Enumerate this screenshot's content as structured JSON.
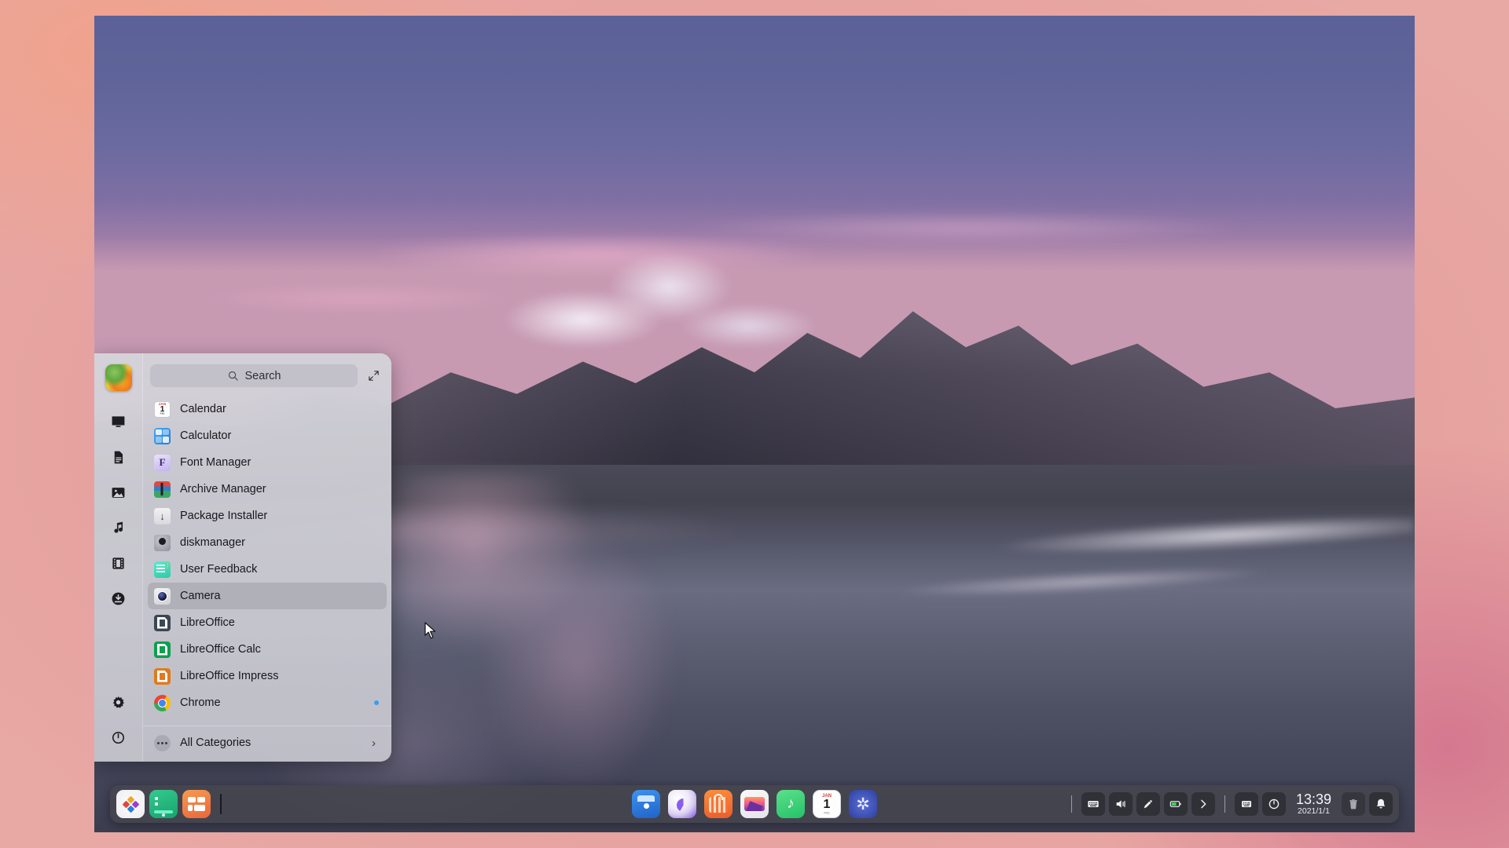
{
  "desktop": {
    "wallpaper_description": "Beach sunset with mountains reflected in wet sand"
  },
  "launcher": {
    "search": {
      "placeholder": "Search",
      "icon": "search-icon"
    },
    "expand_icon": "expand-icon",
    "sidebar": [
      {
        "name": "user-avatar",
        "label": "User Avatar"
      },
      {
        "name": "computer-icon",
        "label": "Computer"
      },
      {
        "name": "documents-icon",
        "label": "Documents"
      },
      {
        "name": "pictures-icon",
        "label": "Pictures"
      },
      {
        "name": "music-icon",
        "label": "Music"
      },
      {
        "name": "videos-icon",
        "label": "Videos"
      },
      {
        "name": "downloads-icon",
        "label": "Downloads"
      },
      {
        "name": "settings-icon",
        "label": "Settings"
      },
      {
        "name": "power-icon",
        "label": "Power"
      }
    ],
    "apps": [
      {
        "label": "Calendar",
        "icon": "calendar-icon",
        "selected": false,
        "badge": false
      },
      {
        "label": "Calculator",
        "icon": "calculator-icon",
        "selected": false,
        "badge": false
      },
      {
        "label": "Font Manager",
        "icon": "font-manager-icon",
        "selected": false,
        "badge": false
      },
      {
        "label": "Archive Manager",
        "icon": "archive-manager-icon",
        "selected": false,
        "badge": false
      },
      {
        "label": "Package Installer",
        "icon": "package-installer-icon",
        "selected": false,
        "badge": false
      },
      {
        "label": "diskmanager",
        "icon": "disk-manager-icon",
        "selected": false,
        "badge": false
      },
      {
        "label": "User Feedback",
        "icon": "user-feedback-icon",
        "selected": false,
        "badge": false
      },
      {
        "label": "Camera",
        "icon": "camera-icon",
        "selected": true,
        "badge": false
      },
      {
        "label": "LibreOffice",
        "icon": "libreoffice-icon",
        "selected": false,
        "badge": false
      },
      {
        "label": "LibreOffice Calc",
        "icon": "libreoffice-calc-icon",
        "selected": false,
        "badge": false
      },
      {
        "label": "LibreOffice Impress",
        "icon": "libreoffice-impress-icon",
        "selected": false,
        "badge": false
      },
      {
        "label": "Chrome",
        "icon": "chrome-icon",
        "selected": false,
        "badge": true
      }
    ],
    "all_categories": {
      "label": "All Categories",
      "icon": "ellipsis-icon",
      "chevron": "›"
    }
  },
  "dock": {
    "left_items": [
      {
        "name": "launcher-button",
        "label": "Launcher",
        "running": false
      },
      {
        "name": "terminal-button",
        "label": "Terminal",
        "running": true
      },
      {
        "name": "app-store-button",
        "label": "App Store",
        "running": false
      }
    ],
    "center_items": [
      {
        "name": "file-manager-button",
        "label": "File Manager"
      },
      {
        "name": "browser-button",
        "label": "Browser"
      },
      {
        "name": "store-button",
        "label": "Store"
      },
      {
        "name": "photos-button",
        "label": "Photos"
      },
      {
        "name": "music-button",
        "label": "Music"
      },
      {
        "name": "calendar-button",
        "label": "Calendar",
        "month": "JAN",
        "day": "1",
        "weekday": "FRI"
      },
      {
        "name": "settings-button",
        "label": "Settings"
      }
    ],
    "tray_items": [
      {
        "name": "keyboard-layout-icon",
        "label": "Keyboard Layout"
      },
      {
        "name": "volume-icon",
        "label": "Volume"
      },
      {
        "name": "brightness-icon",
        "label": "Brightness"
      },
      {
        "name": "battery-icon",
        "label": "Battery"
      },
      {
        "name": "tray-expand-icon",
        "label": "Show More"
      }
    ],
    "tray_items_right": [
      {
        "name": "onscreen-keyboard-icon",
        "label": "On-screen Keyboard"
      },
      {
        "name": "power-menu-icon",
        "label": "Power"
      }
    ],
    "clock": {
      "time": "13:39",
      "date": "2021/1/1"
    },
    "trash": {
      "name": "trash-icon",
      "label": "Trash"
    },
    "notifications": {
      "name": "notification-bell-icon",
      "label": "Notifications"
    }
  },
  "colors": {
    "accent": "#3b9df0",
    "dock_bg": "#464650",
    "menu_bg": "#d4d3da",
    "selection": "#9696a2"
  }
}
